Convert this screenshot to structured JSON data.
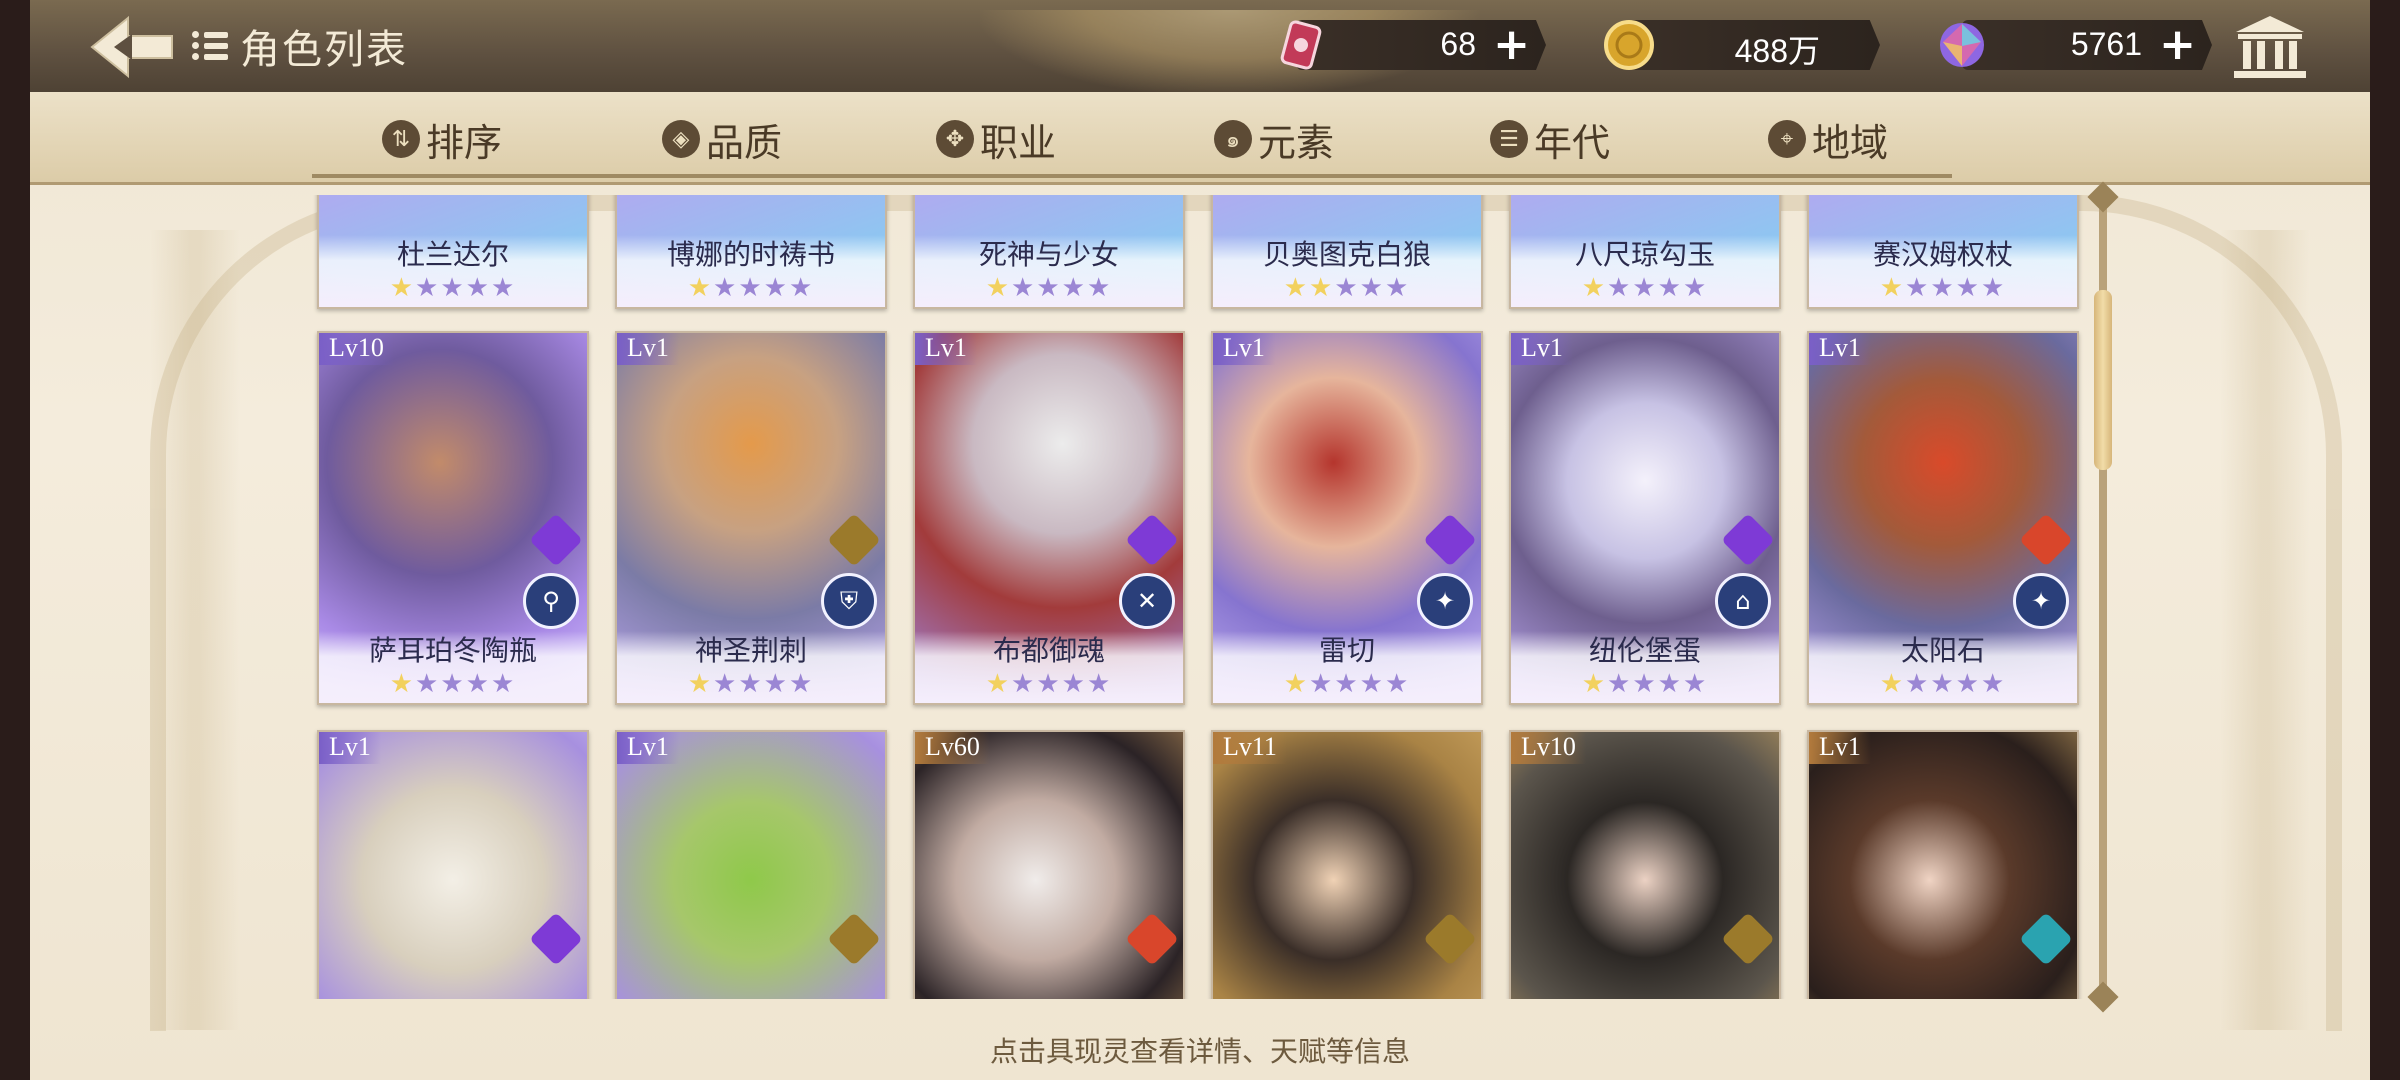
{
  "header": {
    "title": "角色列表",
    "back_icon": "back-arrow-icon",
    "list_icon": "list-icon"
  },
  "resources": [
    {
      "name": "stamina",
      "icon": "can-icon",
      "value": "68"
    },
    {
      "name": "gold",
      "icon": "coin-icon",
      "value": "488万"
    },
    {
      "name": "gem",
      "icon": "crystal-icon",
      "value": "5761"
    }
  ],
  "tabs": [
    {
      "label": "排序",
      "icon": "sort-icon"
    },
    {
      "label": "品质",
      "icon": "quality-icon"
    },
    {
      "label": "职业",
      "icon": "profession-icon"
    },
    {
      "label": "元素",
      "icon": "element-icon"
    },
    {
      "label": "年代",
      "icon": "era-icon"
    },
    {
      "label": "地域",
      "icon": "location-icon"
    }
  ],
  "cards_row1": [
    {
      "name": "杜兰达尔",
      "stars": 1
    },
    {
      "name": "博娜的时祷书",
      "stars": 1
    },
    {
      "name": "死神与少女",
      "stars": 1
    },
    {
      "name": "贝奥图克白狼",
      "stars": 2
    },
    {
      "name": "八尺琼勾玉",
      "stars": 1
    },
    {
      "name": "赛汉姆权杖",
      "stars": 1
    }
  ],
  "cards_row2": [
    {
      "name": "萨耳珀冬陶瓶",
      "lv": "Lv10",
      "stars": 1,
      "element": "#7e3ad6",
      "cls": "⚲"
    },
    {
      "name": "神圣荆刺",
      "lv": "Lv1",
      "stars": 1,
      "element": "#9b7a2b",
      "cls": "⛨"
    },
    {
      "name": "布都御魂",
      "lv": "Lv1",
      "stars": 1,
      "element": "#7e3ad6",
      "cls": "✕"
    },
    {
      "name": "雷切",
      "lv": "Lv1",
      "stars": 1,
      "element": "#7e3ad6",
      "cls": "✦"
    },
    {
      "name": "纽伦堡蛋",
      "lv": "Lv1",
      "stars": 1,
      "element": "#7e3ad6",
      "cls": "⌂"
    },
    {
      "name": "太阳石",
      "lv": "Lv1",
      "stars": 1,
      "element": "#d9462b",
      "cls": "✦"
    }
  ],
  "cards_row3": [
    {
      "lv": "Lv1",
      "element": "#7e3ad6"
    },
    {
      "lv": "Lv1",
      "element": "#9b7a2b"
    },
    {
      "lv": "Lv60",
      "element": "#d9462b"
    },
    {
      "lv": "Lv11",
      "element": "#9b7a2b"
    },
    {
      "lv": "Lv10",
      "element": "#9b7a2b"
    },
    {
      "lv": "Lv1",
      "element": "#2aa3b0"
    }
  ],
  "footer": {
    "hint": "点击具现灵查看详情、天赋等信息"
  },
  "colors": {
    "header_bg": "#5e5040",
    "tab_bg": "#e4d6b6",
    "card_purple": "#cbb7ea",
    "card_gold": "#e2c089",
    "star_on": "#f2d15e",
    "star_off": "#9b86d4"
  }
}
